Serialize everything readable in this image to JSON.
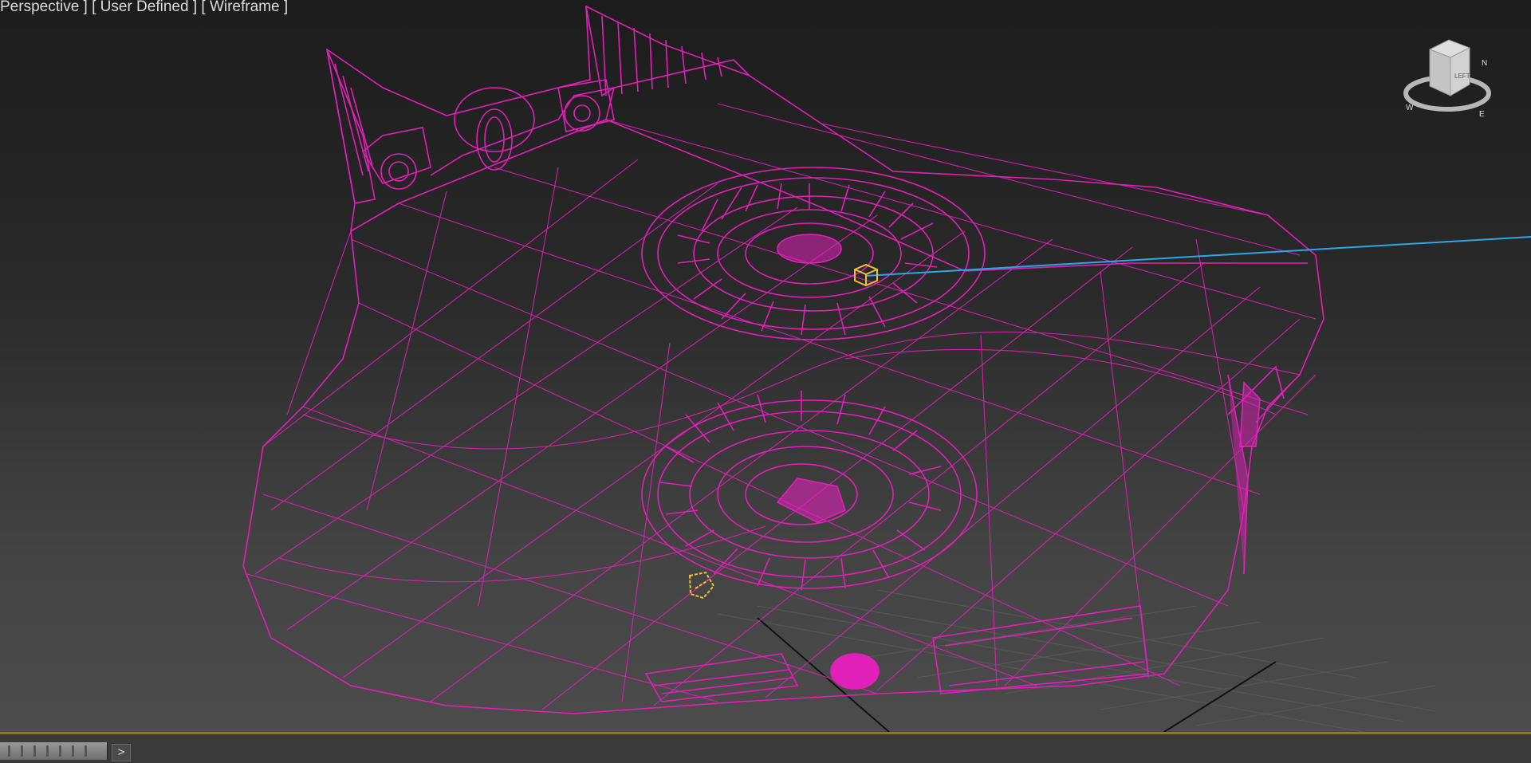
{
  "viewport": {
    "label_perspective": "Perspective ]",
    "label_user_defined": "[ User Defined ]",
    "label_wireframe": "[ Wireframe ]"
  },
  "scene": {
    "wire_color": "#e020b8",
    "selection_color": "#f2c12e",
    "axis_line_color": "#2aa8e8",
    "grid_color": "#5c5c5c"
  },
  "viewcube": {
    "icon": "viewcube-icon",
    "face_text": "LEFT",
    "compass_n": "N",
    "compass_w": "W",
    "compass_e": "E"
  },
  "timeline": {
    "separator_color": "#8c7432",
    "expand_label": ">"
  }
}
